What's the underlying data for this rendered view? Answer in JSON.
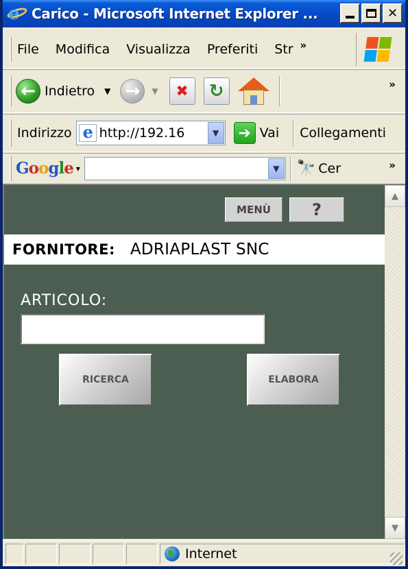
{
  "window": {
    "title": "Carico - Microsoft Internet Explorer ...",
    "minimize_icon": "minimize-icon",
    "maximize_icon": "maximize-icon",
    "close_glyph": "✕"
  },
  "menubar": {
    "items": [
      "File",
      "Modifica",
      "Visualizza",
      "Preferiti",
      "Str"
    ],
    "overflow_glyph": "»"
  },
  "toolbar": {
    "back_label": "Indietro",
    "back_glyph": "←",
    "forward_glyph": "→",
    "stop_glyph": "✖",
    "refresh_glyph": "↻",
    "dropdown_glyph": "▼",
    "overflow_glyph": "»"
  },
  "addressbar": {
    "label": "Indirizzo",
    "url": "http://192.16",
    "go_label": "Vai",
    "go_glyph": "➔",
    "links_label": "Collegamenti",
    "dropdown_glyph": "▼"
  },
  "googlebar": {
    "logo_letters": [
      "G",
      "o",
      "o",
      "g",
      "l",
      "e"
    ],
    "logo_dropdown": "▾",
    "search_value": "",
    "dropdown_glyph": "▼",
    "binoculars_glyph": "🔭",
    "search_label": "Cer",
    "overflow_glyph": "»"
  },
  "page": {
    "menu_button": "MENÙ",
    "help_button": "?",
    "supplier_label": "FORNITORE:",
    "supplier_value": "ADRIAPLAST SNC",
    "article_label": "ARTICOLO:",
    "article_value": "",
    "search_button": "RICERCA",
    "process_button": "ELABORA",
    "background_color": "#4C5E51"
  },
  "scrollbar": {
    "up_glyph": "▲",
    "down_glyph": "▼"
  },
  "statusbar": {
    "zone_label": "Internet"
  }
}
